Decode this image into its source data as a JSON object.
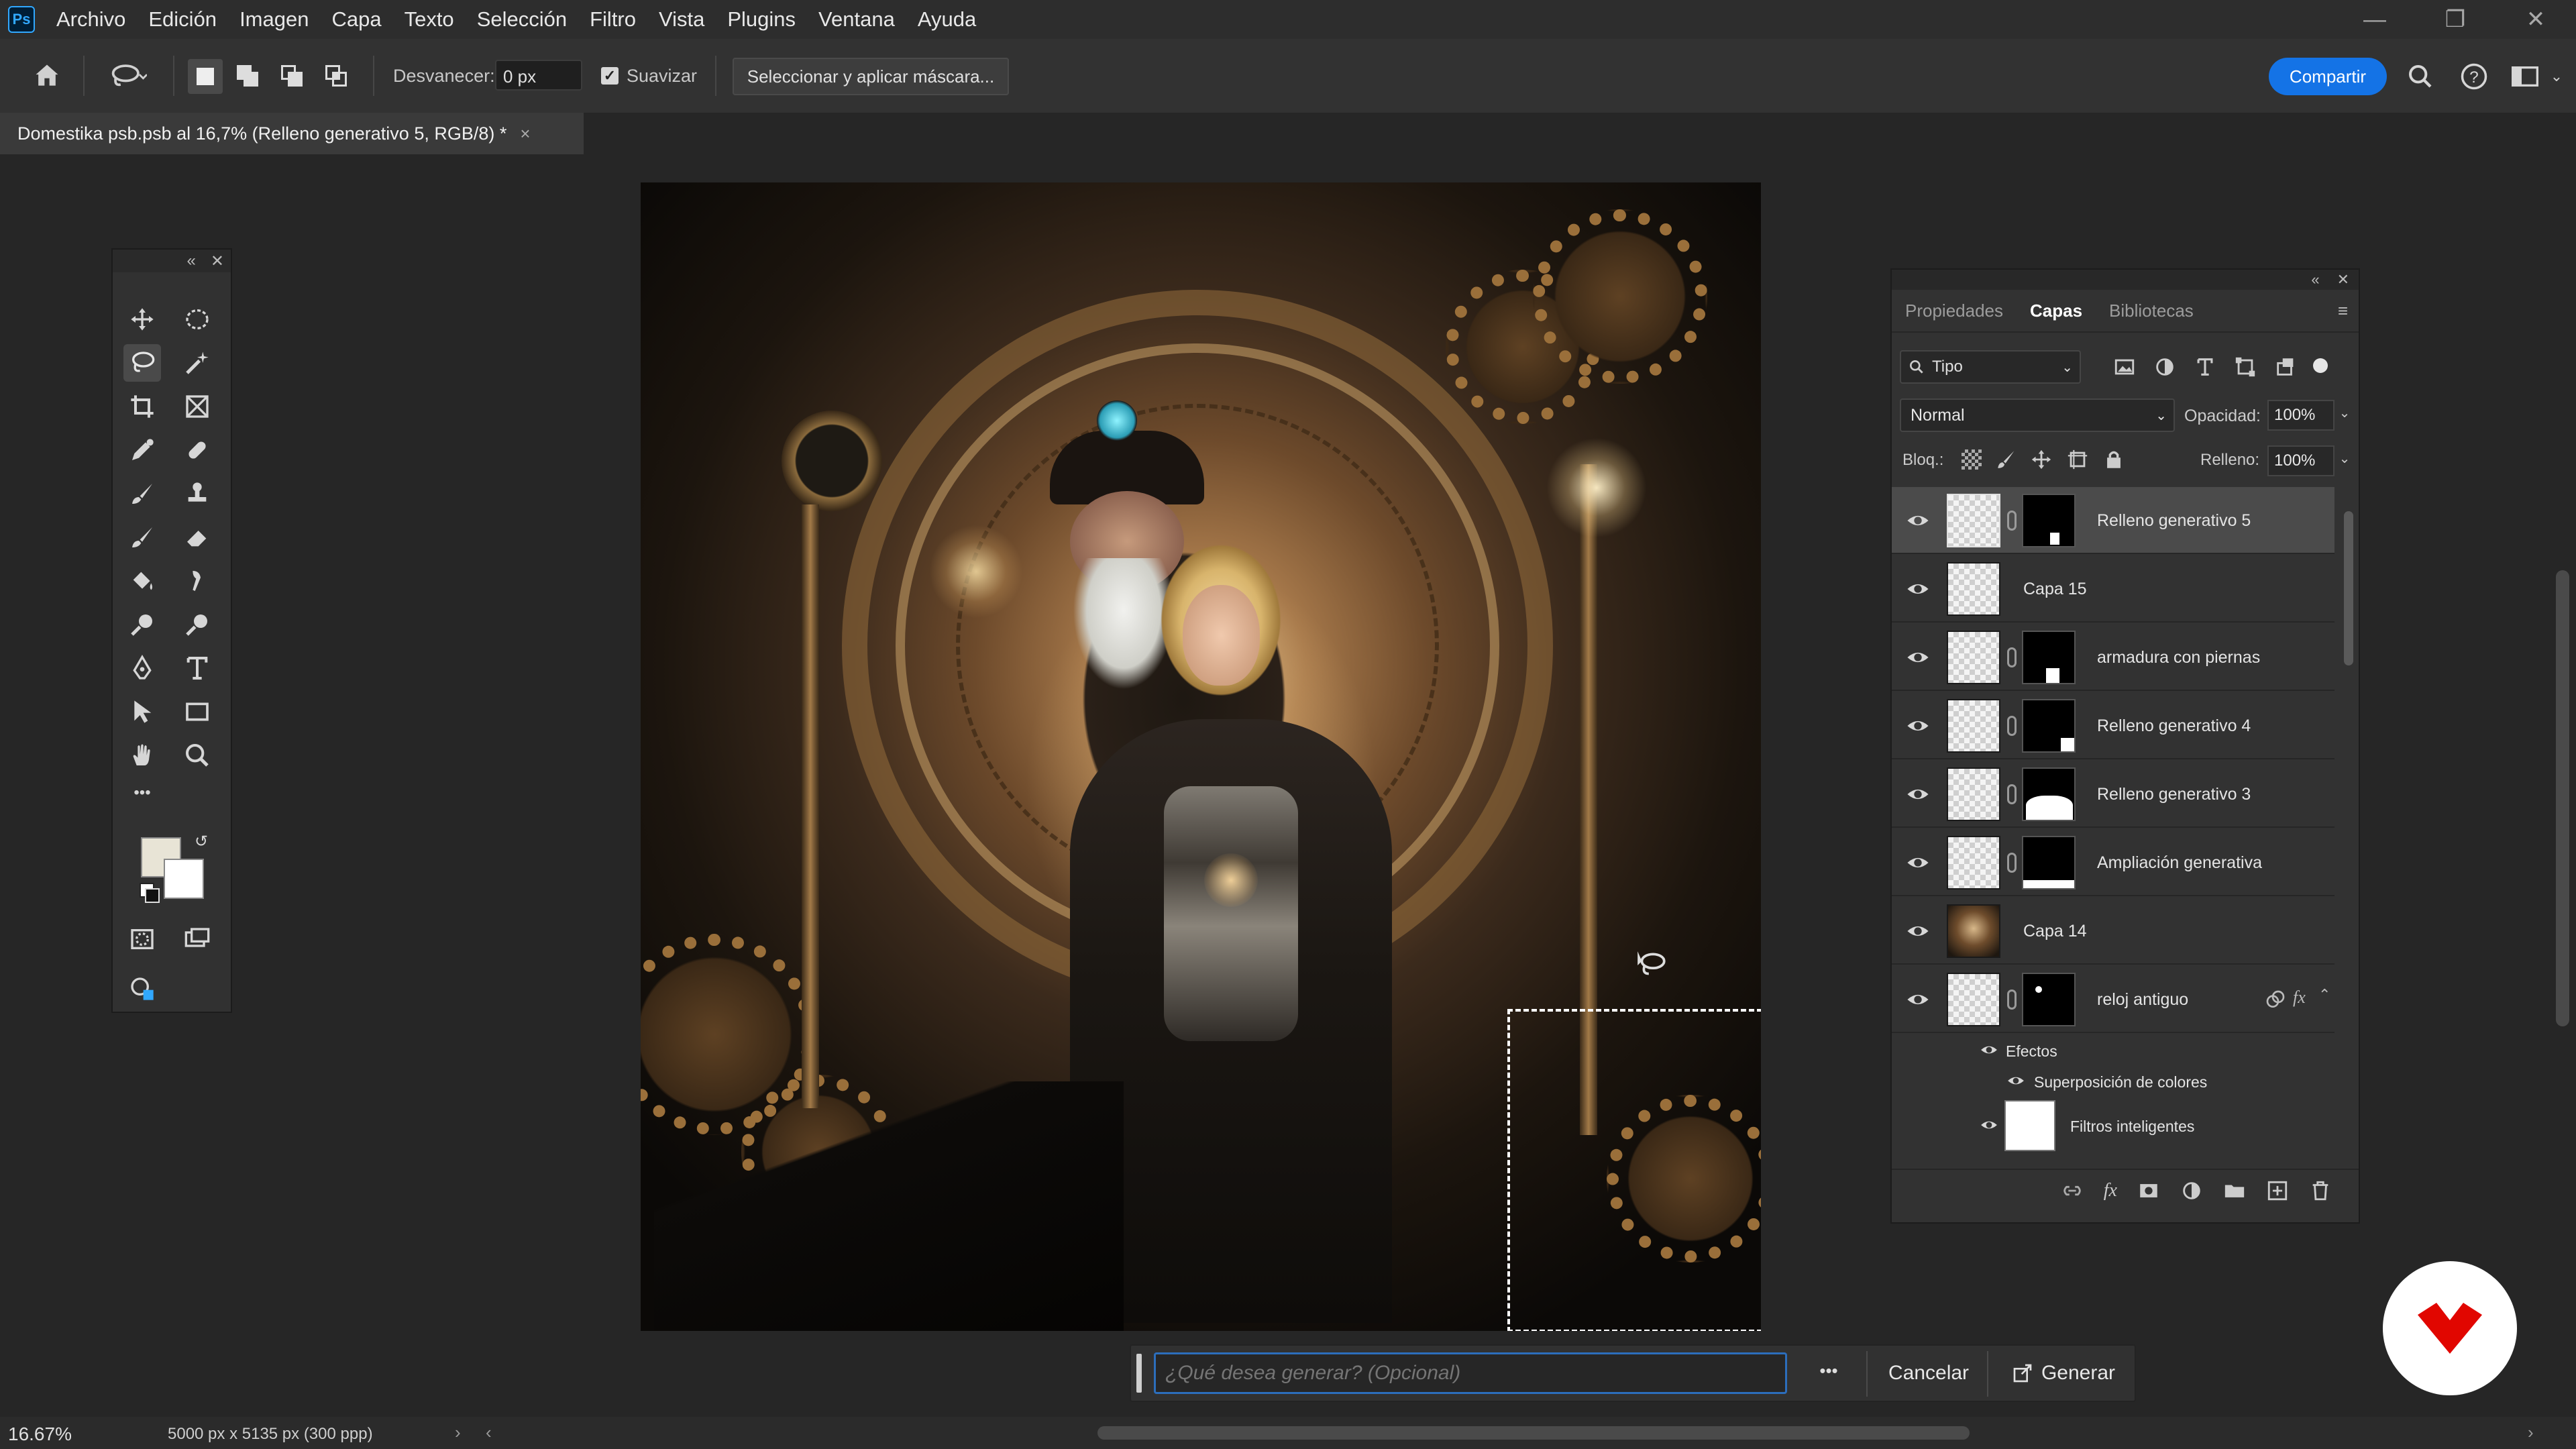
{
  "menu": {
    "logo": "Ps",
    "items": [
      "Archivo",
      "Edición",
      "Imagen",
      "Capa",
      "Texto",
      "Selección",
      "Filtro",
      "Vista",
      "Plugins",
      "Ventana",
      "Ayuda"
    ]
  },
  "options_bar": {
    "feather_label": "Desvanecer:",
    "feather_value": "0 px",
    "smooth_label": "Suavizar",
    "smooth_checked": true,
    "mask_button": "Seleccionar y aplicar máscara...",
    "share_button": "Compartir"
  },
  "document_tab": {
    "title": "Domestika psb.psb al 16,7% (Relleno generativo 5, RGB/8) *",
    "close": "×"
  },
  "tools_panel": {
    "collapse": "«",
    "close": "✕",
    "more": "•••"
  },
  "layers_panel": {
    "tabs": [
      "Propiedades",
      "Capas",
      "Bibliotecas"
    ],
    "active_tab": "Capas",
    "filter_kind": "Tipo",
    "blend_mode": "Normal",
    "opacity_label": "Opacidad:",
    "opacity_value": "100%",
    "lock_label": "Bloq.:",
    "fill_label": "Relleno:",
    "fill_value": "100%",
    "layers": [
      {
        "name": "Relleno generativo 5",
        "selected": true,
        "has_mask": true
      },
      {
        "name": "Capa 15",
        "selected": false,
        "has_mask": false
      },
      {
        "name": "armadura con piernas",
        "selected": false,
        "has_mask": true
      },
      {
        "name": "Relleno generativo 4",
        "selected": false,
        "has_mask": true
      },
      {
        "name": "Relleno generativo 3",
        "selected": false,
        "has_mask": true
      },
      {
        "name": "Ampliación generativa",
        "selected": false,
        "has_mask": true
      },
      {
        "name": "Capa 14",
        "selected": false,
        "has_mask": false
      },
      {
        "name": "reloj antiguo",
        "selected": false,
        "has_mask": true
      }
    ],
    "effects_label": "Efectos",
    "effect_item": "Superposición de colores",
    "smart_filters": "Filtros inteligentes",
    "fx": "fx"
  },
  "generate_bar": {
    "placeholder": "¿Qué desea generar? (Opcional)",
    "more": "•••",
    "cancel": "Cancelar",
    "generate": "Generar"
  },
  "status_bar": {
    "zoom": "16.67%",
    "doc_info": "5000 px x 5135 px (300 ppp)"
  },
  "colors": {
    "accent": "#1473e6",
    "panel": "#323232",
    "background": "#262626"
  }
}
